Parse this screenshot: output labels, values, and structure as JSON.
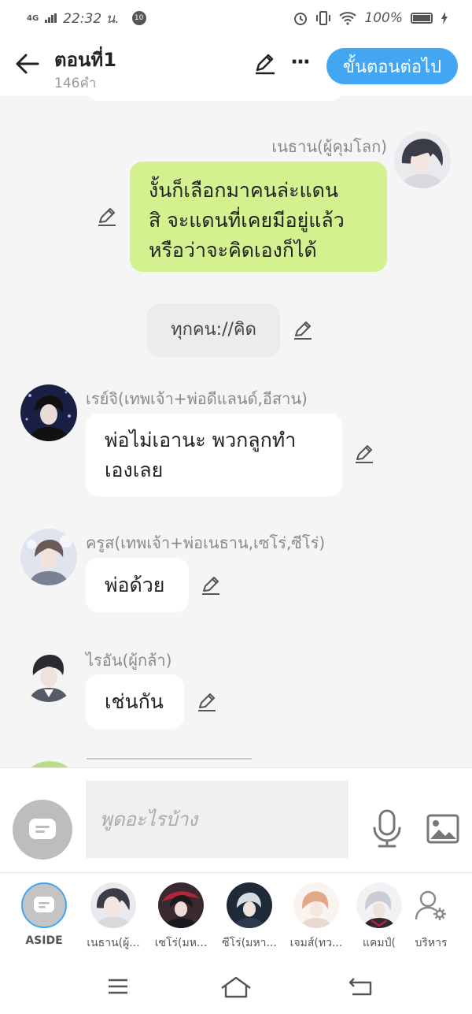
{
  "status_bar": {
    "network": "4G",
    "time": "22:32 น.",
    "notification_count": "10",
    "battery": "100%"
  },
  "header": {
    "title": "ตอนที่1",
    "word_count": "146คำ",
    "next_button": "ขั้นตอนต่อไป"
  },
  "messages": [
    {
      "type": "own",
      "name": "เนธาน(ผู้คุมโลก)",
      "text_lines": [
        "งั้นก็เลือกมาคนล่ะแดน",
        "สิ จะแดนที่เคยมีอยู่แล้ว",
        "หรือว่าจะคิดเองก็ได้"
      ]
    },
    {
      "type": "narration",
      "text": "ทุกคน://คิด"
    },
    {
      "type": "other",
      "name": "เรย์จิ(เทพเจ้า+พ่อดีแลนด์,อีสาน)",
      "text_lines": [
        "พ่อไม่เอานะ พวกลูกทำ",
        "เองเลย"
      ]
    },
    {
      "type": "other",
      "name": "ครูส(เทพเจ้า+พ่อเนธาน,เซโร่,ซีโร่)",
      "text_lines": [
        "พ่อด้วย"
      ]
    },
    {
      "type": "other",
      "name": "ไรอัน(ผู้กล้า)",
      "text_lines": [
        "เช่นกัน"
      ]
    }
  ],
  "input": {
    "placeholder": "พูดอะไรบ้าง"
  },
  "characters": [
    {
      "label": "ASIDE"
    },
    {
      "label": "เนธาน(ผู้..."
    },
    {
      "label": "เซโร่(มห..."
    },
    {
      "label": "ซีโร่(มหา..."
    },
    {
      "label": "เจมส์(ทว..."
    },
    {
      "label": "แคมป์("
    },
    {
      "label": "บริหาร"
    }
  ],
  "colors": {
    "accent": "#42a6f2",
    "own_bubble": "#d4f18f",
    "chat_background": "#f5f5f5"
  },
  "icons": [
    "back-arrow-icon",
    "pencil-icon",
    "more-icon",
    "microphone-icon",
    "image-icon",
    "aside-icon",
    "manage-characters-icon",
    "menu-icon",
    "home-icon",
    "return-icon"
  ]
}
